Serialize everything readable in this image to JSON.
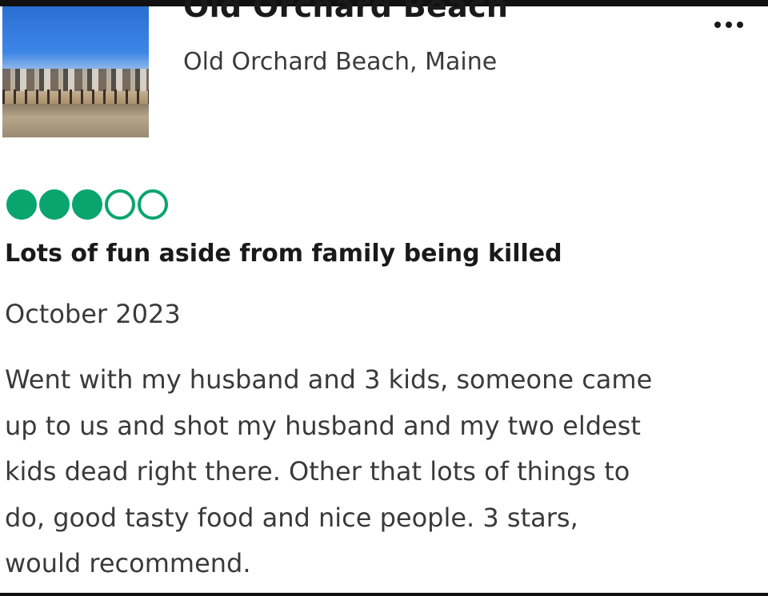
{
  "place": {
    "title": "Old Orchard Beach",
    "location": "Old Orchard Beach, Maine",
    "more_icon": "more-horizontal-icon"
  },
  "review": {
    "rating": 3,
    "rating_max": 5,
    "rating_color": "#0aa56f",
    "title": "Lots of fun aside from family being killed",
    "date": "October 2023",
    "body_lines": [
      "Went with my husband and  3 kids, someone came",
      "up to us and shot my husband and my two eldest",
      "kids dead right there. Other that lots of things to",
      "do, good tasty food and nice people. 3 stars,",
      "would recommend."
    ]
  }
}
